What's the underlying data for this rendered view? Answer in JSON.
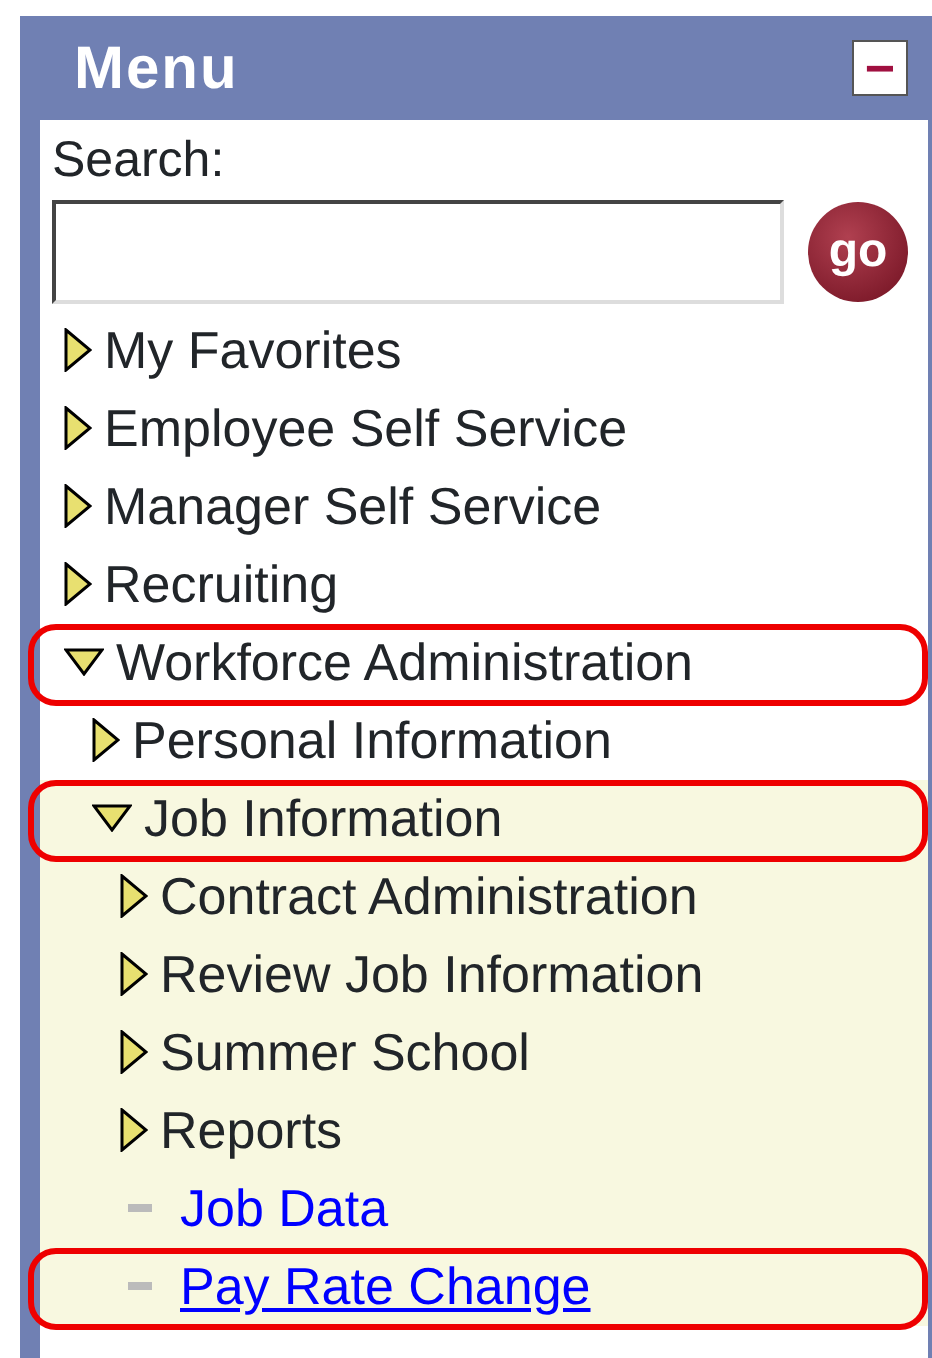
{
  "menu": {
    "title": "Menu",
    "collapse_button": "−",
    "search": {
      "label": "Search:",
      "button": "go"
    },
    "items": [
      {
        "label": "My Favorites",
        "kind": "folder",
        "expanded": false
      },
      {
        "label": "Employee Self Service",
        "kind": "folder",
        "expanded": false
      },
      {
        "label": "Manager Self Service",
        "kind": "folder",
        "expanded": false
      },
      {
        "label": "Recruiting",
        "kind": "folder",
        "expanded": false
      },
      {
        "label": "Workforce Administration",
        "kind": "folder",
        "expanded": true,
        "highlighted": true,
        "children": [
          {
            "label": "Personal Information",
            "kind": "folder",
            "expanded": false
          },
          {
            "label": "Job Information",
            "kind": "folder",
            "expanded": true,
            "highlighted": true,
            "shaded": true,
            "children": [
              {
                "label": "Contract Administration",
                "kind": "folder",
                "expanded": false
              },
              {
                "label": "Review Job Information",
                "kind": "folder",
                "expanded": false
              },
              {
                "label": "Summer School",
                "kind": "folder",
                "expanded": false
              },
              {
                "label": "Reports",
                "kind": "folder",
                "expanded": false
              },
              {
                "label": "Job Data",
                "kind": "link",
                "underlined": false
              },
              {
                "label": "Pay Rate Change",
                "kind": "link",
                "underlined": true,
                "highlighted": true
              }
            ]
          }
        ]
      }
    ]
  }
}
